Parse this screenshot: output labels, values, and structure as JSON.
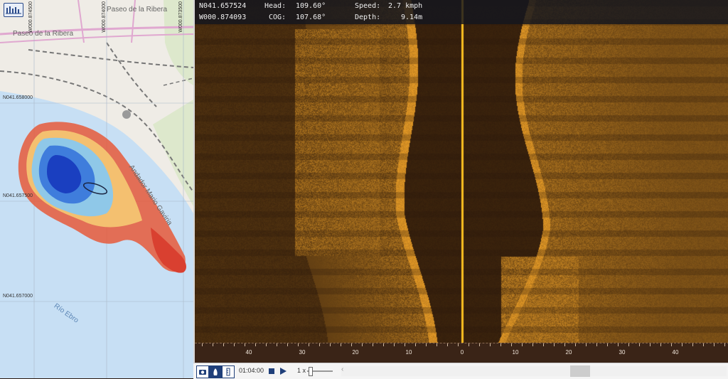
{
  "map": {
    "lat_labels": [
      "N041.658000",
      "N041.657500",
      "N041.657000"
    ],
    "lon_labels": [
      "W000.874500",
      "W000.874000",
      "W000.873500"
    ],
    "streets": [
      "Paseo de la Ribera",
      "Paseo de la Ribera",
      "Andador Mario Gaviria"
    ],
    "water_label": "Río Ebro",
    "tool_icon": "depth-chart-icon"
  },
  "telemetry": {
    "lat": "N041.657524",
    "lon": "W000.874093",
    "head_label": "Head:",
    "head_value": "109.60°",
    "cog_label": "COG:",
    "cog_value": "107.68°",
    "speed_label": "Speed:",
    "speed_value": "2.7 kmph",
    "depth_label": "Depth:",
    "depth_value": "9.14m"
  },
  "range_axis": {
    "labels": [
      "40",
      "30",
      "20",
      "10",
      "0",
      "10",
      "20",
      "30",
      "40"
    ]
  },
  "controls": {
    "time": "01:04:00",
    "speed": "1 x",
    "icons": [
      "camera-icon",
      "boat-view-icon",
      "ruler-icon",
      "stop-icon",
      "play-icon"
    ]
  },
  "colors": {
    "sonar_bg": "#2b1a10",
    "sonar_highlight": "#e0a020",
    "nadir_line": "#ffc020",
    "telemetry_bg": "#14161e"
  }
}
